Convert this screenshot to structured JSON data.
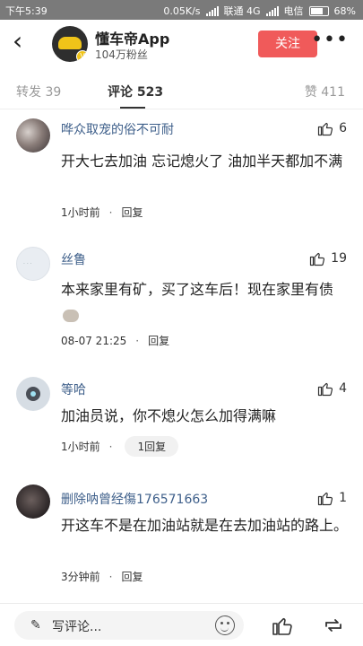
{
  "statusbar": {
    "time": "下午5:39",
    "network": "0.05K/s",
    "carrier1": "联通 4G",
    "carrier2": "电信",
    "battery": "68%",
    "battery_level": 0.68
  },
  "header": {
    "back_icon": "back-arrow-icon",
    "account_name": "懂车帝App",
    "fans": "104万粉丝",
    "follow_label": "关注",
    "more_icon": "more-dots-icon",
    "follow_color": "#f05a5a"
  },
  "tabs": {
    "repost": "转发 39",
    "comment": "评论 523",
    "like": "赞 411"
  },
  "comments": [
    {
      "username": "哗众取宠的俗不可耐",
      "likes": "6",
      "text": "开大七去加油 忘记熄火了 油加半天都加不满",
      "time": "1小时前",
      "reply": "回复"
    },
    {
      "username": "丝鲁",
      "likes": "19",
      "text": "本来家里有矿，买了这车后！现在家里有债",
      "time": "08-07 21:25",
      "reply": "回复"
    },
    {
      "username": "等哈",
      "likes": "4",
      "text": "加油员说，你不熄火怎么加得满嘛",
      "time": "1小时前",
      "reply": "1回复"
    },
    {
      "username": "删除呐曾经傷176571663",
      "likes": "1",
      "text": "开这车不是在加油站就是在去加油站的路上。",
      "time": "3分钟前",
      "reply": "回复"
    }
  ],
  "bottombar": {
    "input_placeholder": "写评论...",
    "icons": [
      "pen-icon",
      "emoji-icon",
      "thumbs-up-icon",
      "repost-icon"
    ]
  }
}
